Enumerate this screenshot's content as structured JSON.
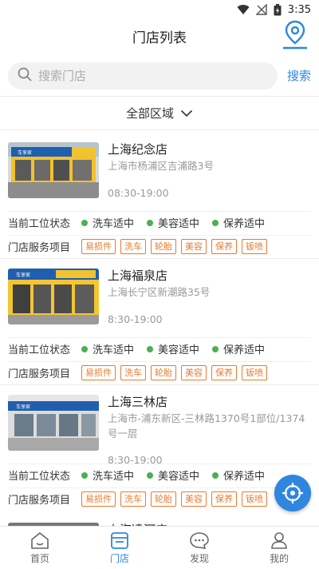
{
  "status_bar": {
    "time": "3:35"
  },
  "header": {
    "title": "门店列表"
  },
  "search": {
    "placeholder": "搜索门店",
    "button_label": "搜索"
  },
  "region_filter": {
    "label": "全部区域"
  },
  "row_labels": {
    "status": "当前工位状态",
    "services": "门店服务项目"
  },
  "stores": [
    {
      "name": "上海纪念店",
      "address": "上海市杨浦区吉浦路3号",
      "hours": "08:30-19:00",
      "status": [
        "洗车适中",
        "美容适中",
        "保养适中"
      ],
      "services": [
        "易损件",
        "洗车",
        "轮胎",
        "美容",
        "保养",
        "钣喷"
      ]
    },
    {
      "name": "上海福泉店",
      "address": "上海长宁区新潮路35号",
      "hours": "8:30-19:00",
      "status": [
        "洗车适中",
        "美容适中",
        "保养适中"
      ],
      "services": [
        "易损件",
        "洗车",
        "轮胎",
        "美容",
        "保养",
        "钣喷"
      ]
    },
    {
      "name": "上海三林店",
      "address": "上海市-浦东新区-三林路1370号1部位/1374号一层",
      "hours": "8:30-19:00",
      "status": [
        "洗车适中",
        "美容适中",
        "保养适中"
      ],
      "services": [
        "易损件",
        "洗车",
        "轮胎",
        "美容",
        "保养",
        "钣喷"
      ]
    },
    {
      "name": "上海凌河店"
    }
  ],
  "bottom_nav": [
    {
      "label": "首页",
      "icon": "home-icon"
    },
    {
      "label": "门店",
      "icon": "store-icon"
    },
    {
      "label": "发现",
      "icon": "discover-icon"
    },
    {
      "label": "我的",
      "icon": "user-icon"
    }
  ],
  "colors": {
    "accent": "#2e86de",
    "status_dot": "#4caf50",
    "tag": "#e87a2f"
  }
}
